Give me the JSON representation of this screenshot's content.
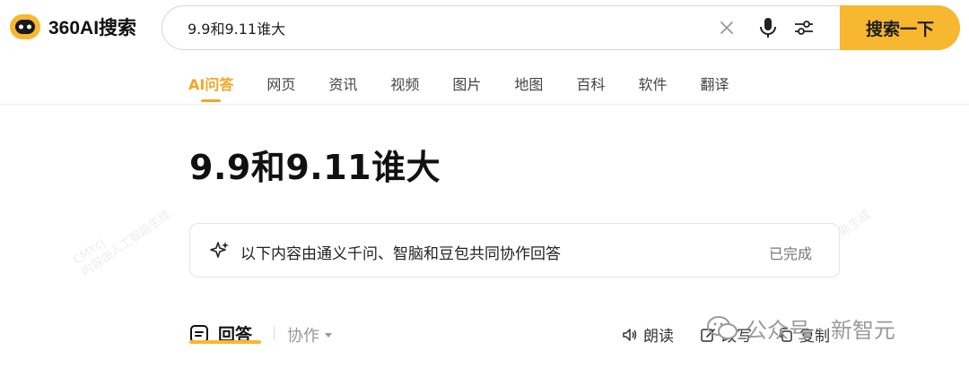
{
  "logo": {
    "text": "360AI搜索"
  },
  "search": {
    "query": "9.9和9.11谁大",
    "button_label": "搜索一下"
  },
  "tabs": [
    {
      "label": "AI问答",
      "active": true
    },
    {
      "label": "网页"
    },
    {
      "label": "资讯"
    },
    {
      "label": "视频"
    },
    {
      "label": "图片"
    },
    {
      "label": "地图"
    },
    {
      "label": "百科"
    },
    {
      "label": "软件"
    },
    {
      "label": "翻译"
    }
  ],
  "query_title": "9.9和9.11谁大",
  "info_card": {
    "text": "以下内容由通义千问、智脑和豆包共同协作回答",
    "status": "已完成"
  },
  "watermark": {
    "line1": "CMYcj",
    "line2": "内容由人工智能生成"
  },
  "answer_bar": {
    "answer_label": "回答",
    "collab_label": "协作",
    "read_label": "朗读",
    "rewrite_label": "改写",
    "copy_label": "复制"
  },
  "brand_watermark": {
    "text": "公众号 · 新智元"
  },
  "colors": {
    "accent": "#f7b731",
    "accent_text": "#f5a623"
  }
}
